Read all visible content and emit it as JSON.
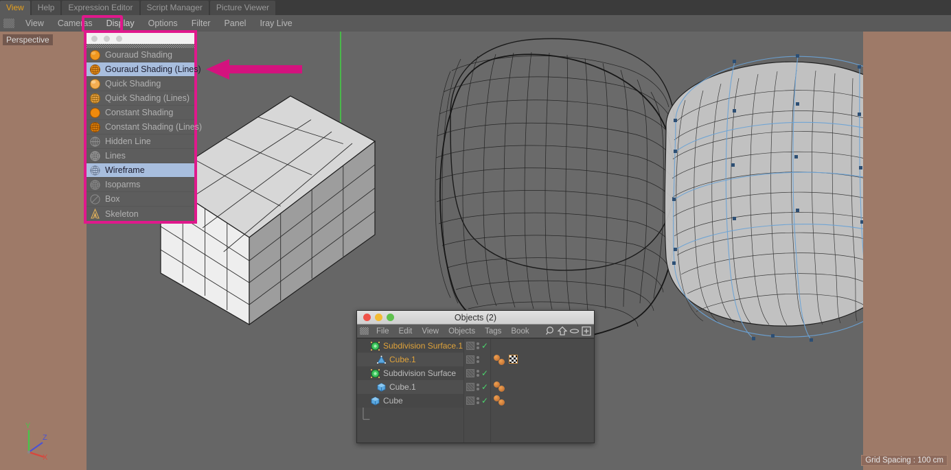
{
  "colors": {
    "accent_magenta": "#e0188c",
    "viewport_grey": "#666666",
    "viewport_border_brown": "#9e7a68",
    "menu_highlight_blue": "#a8bede",
    "active_tab_text": "#e8a11c",
    "selection_cage_blue": "#6ba3d6",
    "tag_orange": "#d88a3c",
    "check_green": "#4ad66d"
  },
  "tabstrip": {
    "tabs": [
      {
        "label": "View",
        "active": true
      },
      {
        "label": "Help",
        "active": false
      },
      {
        "label": "Expression Editor",
        "active": false
      },
      {
        "label": "Script Manager",
        "active": false
      },
      {
        "label": "Picture Viewer",
        "active": false
      }
    ]
  },
  "menubar": {
    "grip_icon": "grip-dots-icon",
    "items": [
      {
        "label": "View",
        "highlighted": false
      },
      {
        "label": "Cameras",
        "highlighted": false
      },
      {
        "label": "Display",
        "highlighted": true
      },
      {
        "label": "Options",
        "highlighted": false
      },
      {
        "label": "Filter",
        "highlighted": false
      },
      {
        "label": "Panel",
        "highlighted": false
      },
      {
        "label": "Iray Live",
        "highlighted": false
      }
    ],
    "nav_icons": [
      "pan-move-icon",
      "zoom-dolly-icon",
      "rotate-orbit-icon",
      "maximize-viewport-icon"
    ]
  },
  "viewport": {
    "camera_label": "Perspective",
    "grid_label": "Grid Spacing : 100 cm",
    "axis_gizmo": {
      "y": "Y",
      "z": "Z",
      "x": "X"
    },
    "annotation_arrow": "magenta-pointer-arrow"
  },
  "display_menu": {
    "title_dots": 3,
    "items": [
      {
        "label": "Gouraud Shading",
        "icon": "sphere-solid-icon",
        "selected": false
      },
      {
        "label": "Gouraud Shading (Lines)",
        "icon": "sphere-wireframe-icon",
        "selected": true
      },
      {
        "label": "Quick Shading",
        "icon": "sphere-solid-icon",
        "selected": false
      },
      {
        "label": "Quick Shading (Lines)",
        "icon": "sphere-wireframe-icon",
        "selected": false
      },
      {
        "label": "Constant Shading",
        "icon": "sphere-solid-icon",
        "selected": false
      },
      {
        "label": "Constant Shading (Lines)",
        "icon": "sphere-wireframe-icon",
        "selected": false
      },
      {
        "label": "Hidden Line",
        "icon": "globe-grey-icon",
        "selected": false
      },
      {
        "label": "Lines",
        "icon": "globe-grey-icon",
        "selected": false
      },
      {
        "label": "Wireframe",
        "icon": "globe-grey-icon",
        "selected": true
      },
      {
        "label": "Isoparms",
        "icon": "globe-grey-icon",
        "selected": false
      },
      {
        "label": "Box",
        "icon": "circle-slash-icon",
        "selected": false
      },
      {
        "label": "Skeleton",
        "icon": "skeleton-a-icon",
        "selected": false
      }
    ]
  },
  "objects_window": {
    "title": "Objects (2)",
    "window_buttons": [
      "close-button",
      "minimize-button",
      "zoom-button"
    ],
    "menu": {
      "grip_icon": "grip-dots-icon",
      "items": [
        "File",
        "Edit",
        "View",
        "Objects",
        "Tags",
        "Book"
      ],
      "icons": [
        "search-icon",
        "home-icon",
        "eye-icon",
        "add-layer-icon"
      ]
    },
    "rows": [
      {
        "label": "Subdivision Surface.1",
        "icon": "subdivision-surface-icon",
        "indent": 0,
        "orange": true,
        "check": true,
        "tags": []
      },
      {
        "label": "Cube.1",
        "icon": "polygon-mesh-icon",
        "indent": 1,
        "orange": true,
        "check": false,
        "tags": [
          "material-tag",
          "texture-checker-tag"
        ]
      },
      {
        "label": "Subdivision Surface",
        "icon": "subdivision-surface-icon",
        "indent": 0,
        "orange": false,
        "check": true,
        "tags": []
      },
      {
        "label": "Cube.1",
        "icon": "cube-primitive-icon",
        "indent": 1,
        "orange": false,
        "check": true,
        "tags": [
          "material-tag"
        ]
      },
      {
        "label": "Cube",
        "icon": "cube-primitive-icon",
        "indent": 1,
        "orange": false,
        "check": true,
        "tags": [
          "material-tag"
        ]
      }
    ]
  }
}
